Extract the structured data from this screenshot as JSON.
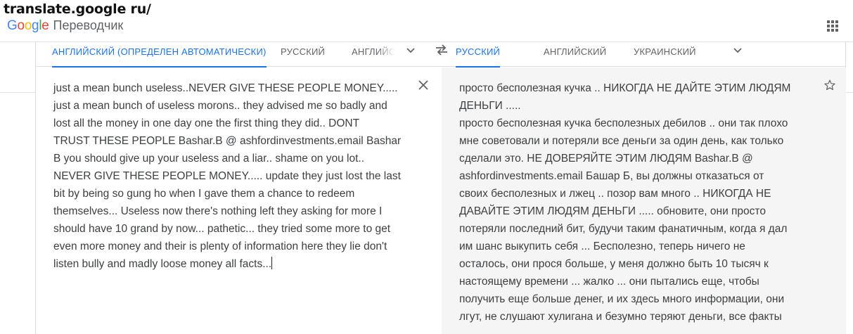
{
  "caption": "translate.google ru/",
  "brand": {
    "logo_letters": [
      "G",
      "o",
      "o",
      "g",
      "l",
      "e"
    ],
    "logo_colors": [
      "#4285f4",
      "#ea4335",
      "#fbbc05",
      "#4285f4",
      "#34a853",
      "#ea4335"
    ],
    "product": "Переводчик"
  },
  "source_langs": {
    "detected": "АНГЛИЙСКИЙ (ОПРЕДЕЛЕН АВТОМАТИЧЕСКИ)",
    "lang2": "РУССКИЙ",
    "lang3": "АНГЛИЙСКИЙ"
  },
  "target_langs": {
    "active": "РУССКИЙ",
    "lang2": "АНГЛИЙСКИЙ",
    "lang3": "УКРАИНСКИЙ"
  },
  "source": {
    "lines": [
      "just a mean bunch useless..NEVER GIVE THESE PEOPLE MONEY.....",
      "just a mean bunch of useless morons.. they advised me so badly and",
      "lost all the money in one day one the first thing they did.. DONT",
      "TRUST THESE PEOPLE Bashar.B @ ashfordinvestments.email Bashar",
      "B you should give up your useless and a liar.. shame on you lot..",
      "NEVER GIVE THESE PEOPLE MONEY..... update they just lost the last",
      "bit by being so gung ho when I gave them a chance to redeem",
      "themselves... Useless now there's nothing left they asking for more I",
      "should have 10 grand by now... pathetic... they tried some more to get",
      "even more money and their is plenty of information here they lie don't",
      "listen bully and madly loose money all facts..."
    ]
  },
  "target": {
    "lines": [
      "просто бесполезная кучка .. НИКОГДА НЕ ДАЙТЕ ЭТИМ ЛЮДЯМ",
      "ДЕНЬГИ .....",
      "просто бесполезная кучка бесполезных дебилов .. они так плохо",
      "мне советовали и потеряли все деньги за один день, как только",
      "сделали это. НЕ ДОВЕРЯЙТЕ ЭТИМ ЛЮДЯМ Bashar.B @",
      "ashfordinvestments.email Башар Б, вы должны отказаться от",
      "своих бесполезных и лжец .. позор вам много .. НИКОГДА НЕ",
      "ДАВАЙТЕ ЭТИМ ЛЮДЯМ ДЕНЬГИ ..... обновите, они просто",
      "потеряли последний бит, будучи таким фанатичным, когда я дал",
      "им шанс выкупить себя ... Бесполезно, теперь ничего не",
      "осталось, они прося больше, у меня должно быть 10 тысяч к",
      "настоящему времени ... жалко ... они пытались еще, чтобы",
      "получить еще больше денег, и их здесь много информации, они",
      "лгут, не слушают хулигана и безумно теряют деньги, все факты"
    ]
  },
  "icons": {
    "apps": "apps-grid-icon",
    "swap": "swap-arrows-icon",
    "chevron": "chevron-down-icon",
    "clear": "close-icon",
    "star": "star-outline-icon"
  },
  "colors": {
    "accent": "#1a73e8",
    "text": "#3c4043",
    "muted": "#5f6368",
    "result_bg": "#f5f5f5"
  }
}
